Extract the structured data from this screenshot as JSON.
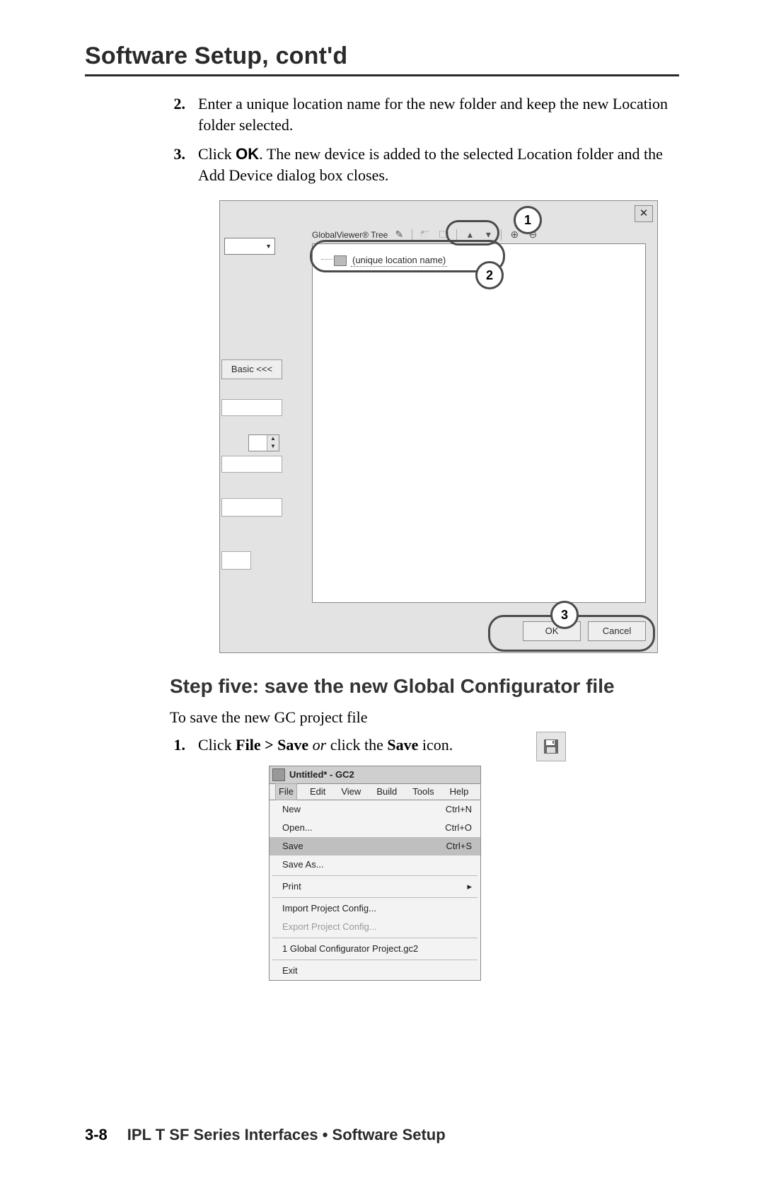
{
  "header": {
    "title": "Software Setup, cont'd"
  },
  "steps_a": {
    "item2_num": "2.",
    "item2_text": "Enter a unique location name for the new folder and keep the new Location folder selected.",
    "item3_num": "3.",
    "item3_pre": "Click ",
    "item3_ok": "OK",
    "item3_post": ".  The new device is added to the selected Location folder and the Add Device dialog box closes."
  },
  "dialog": {
    "tree_label": "GlobalViewer® Tree",
    "node_label": "(unique location name)",
    "basic_label": "Basic <<<",
    "ok_label": "OK",
    "cancel_label": "Cancel"
  },
  "callouts": {
    "c1": "1",
    "c2": "2",
    "c3": "3"
  },
  "step5": {
    "heading": "Step five: save the new Global Configurator file",
    "intro": "To save the new GC project file",
    "item1_num": "1.",
    "item1_pre": "Click ",
    "item1_bold1": "File > Save",
    "item1_mid": " or ",
    "item1_post1": "click the ",
    "item1_bold2": "Save",
    "item1_post2": " icon."
  },
  "menu": {
    "window_title": "Untitled* - GC2",
    "menubar": {
      "file": "File",
      "edit": "Edit",
      "view": "View",
      "build": "Build",
      "tools": "Tools",
      "help": "Help"
    },
    "items": {
      "new": "New",
      "new_sc": "Ctrl+N",
      "open": "Open...",
      "open_sc": "Ctrl+O",
      "save": "Save",
      "save_sc": "Ctrl+S",
      "saveas": "Save As...",
      "print": "Print",
      "import": "Import Project Config...",
      "export": "Export Project Config...",
      "recent": "1 Global Configurator Project.gc2",
      "exit": "Exit"
    }
  },
  "footer": {
    "page": "3-8",
    "text": "IPL T SF Series Interfaces • Software Setup"
  }
}
